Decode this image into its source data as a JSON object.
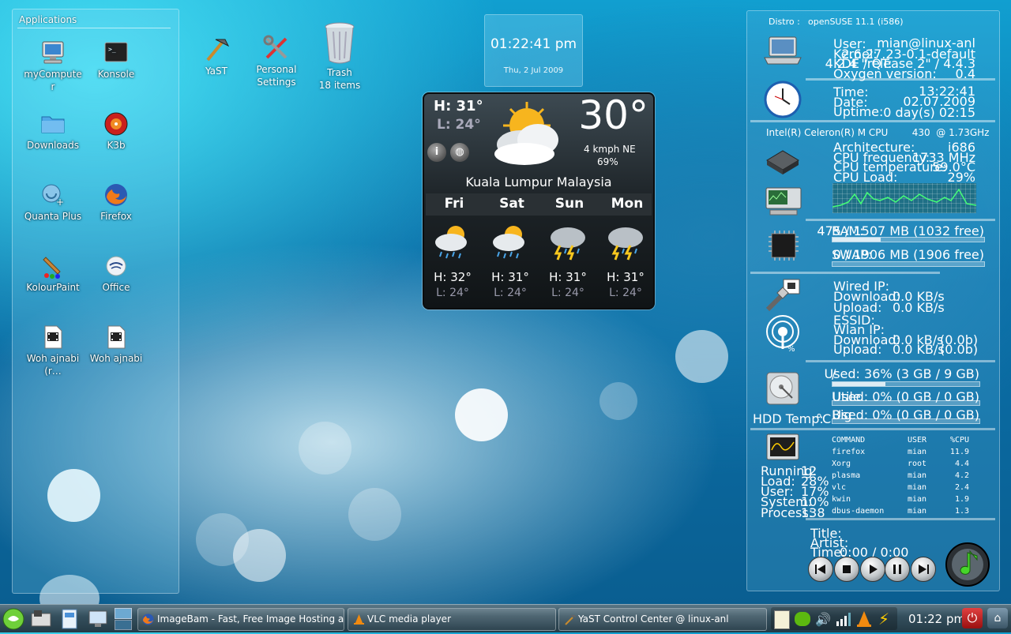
{
  "applications": {
    "title": "Applications",
    "items": [
      {
        "label": "myComputer"
      },
      {
        "label": "Konsole"
      },
      {
        "label": "Downloads"
      },
      {
        "label": "K3b"
      },
      {
        "label": "Quanta Plus"
      },
      {
        "label": "Firefox"
      },
      {
        "label": "KolourPaint"
      },
      {
        "label": "Office"
      },
      {
        "label": "Woh ajnabi (r…"
      },
      {
        "label": "Woh ajnabi"
      }
    ]
  },
  "desktop_icons": {
    "yast": "YaST",
    "personal_settings": "Personal Settings",
    "trash": "Trash",
    "trash_count": "18 items"
  },
  "clock": {
    "time": "01:22:41 pm",
    "date": "Thu, 2 Jul 2009"
  },
  "weather": {
    "high": "H: 31°",
    "low": "L: 24°",
    "temp": "30°",
    "wind": "4 kmph NE",
    "humidity": "69%",
    "city": "Kuala Lumpur Malaysia",
    "forecast": [
      {
        "day": "Fri",
        "hi": "H: 32°",
        "lo": "L: 24°"
      },
      {
        "day": "Sat",
        "hi": "H: 31°",
        "lo": "L: 24°"
      },
      {
        "day": "Sun",
        "hi": "H: 31°",
        "lo": "L: 24°"
      },
      {
        "day": "Mon",
        "hi": "H: 31°",
        "lo": "L: 24°"
      }
    ]
  },
  "sysmon": {
    "distro_label": "Distro :",
    "distro": "openSUSE 11.1 (i586)",
    "user_label": "User:",
    "user": "mian@linux-anl",
    "kernel_label": "Kernel:",
    "kernel": "2.6.27.23-0.1-default",
    "kde_label": "KDE / QT:",
    "kde": "4.2.4 \"release 2\" / 4.4.3",
    "oxygen_label": "Oxygen version:",
    "oxygen": "0.4",
    "time_label": "Time:",
    "time": "13:22:41",
    "date_label": "Date:",
    "date": "02.07.2009",
    "uptime_label": "Uptime:",
    "uptime": "0 day(s)  02:15",
    "cpu_name": "Intel(R) Celeron(R) M CPU        430  @ 1.73GHz",
    "arch_label": "Architecture:",
    "arch": "i686",
    "freq_label": "CPU frequency:",
    "freq": "1733 MHz",
    "temp_label": "CPU temperature:",
    "temp": "59.0°C",
    "load_label": "CPU Load:",
    "load": "29%",
    "ram_label": "RAM:",
    "ram": "475 / 1507 MB (1032 free)",
    "ram_fraction": 0.32,
    "swap_label": "SWAP:",
    "swap": "0 / 1906 MB (1906 free)",
    "swap_fraction": 0.0,
    "wired_label": "Wired IP:",
    "download_label": "Download:",
    "wired_down": "0.0 KB/s",
    "upload_label": "Upload:",
    "wired_up": "0.0 KB/s",
    "essid_label": "ESSID:",
    "wlan_label": "Wlan IP:",
    "wlan_down": "0.0 kB/s",
    "wlan_down_total": "(0.0b)",
    "wlan_up": "0.0 KB/s",
    "wlan_up_total": "(0.0b)",
    "wifi_percent": "%",
    "disks": [
      {
        "mount": "/",
        "used": "Used: 36% (3 GB / 9 GB)",
        "fraction": 0.36
      },
      {
        "mount": "Utile",
        "used": "Used: 0% (0 GB / 0 GB)",
        "fraction": 0.0
      },
      {
        "mount": "Big",
        "used": "Used: 0% (0 GB / 0 GB)",
        "fraction": 0.0
      }
    ],
    "hdd_temp_label": "HDD Temp:",
    "hdd_temp_unit": "°C",
    "proc_headers": [
      "COMMAND",
      "USER",
      "%CPU"
    ],
    "processes": [
      [
        "firefox",
        "mian",
        "11.9"
      ],
      [
        "Xorg",
        "root",
        "4.4"
      ],
      [
        "plasma",
        "mian",
        "4.2"
      ],
      [
        "vlc",
        "mian",
        "2.4"
      ],
      [
        "kwin",
        "mian",
        "1.9"
      ],
      [
        "dbus-daemon",
        "mian",
        "1.3"
      ]
    ],
    "running_label": "Running:",
    "running": "12",
    "loadp_label": "Load:",
    "loadp": "28%",
    "userp_label": "User:",
    "userp": "17%",
    "system_label": "System:",
    "system": "10%",
    "process_label": "Process:",
    "process": "138",
    "title_label": "Title:",
    "artist_label": "Artist:",
    "ptime_label": "Time:",
    "ptime": "0:00 / 0:00"
  },
  "taskbar": {
    "tasks": [
      "ImageBam - Fast, Free Image Hosting and",
      "VLC media player",
      "YaST Control Center @ linux-anl"
    ],
    "clock": "01:22 pm"
  }
}
